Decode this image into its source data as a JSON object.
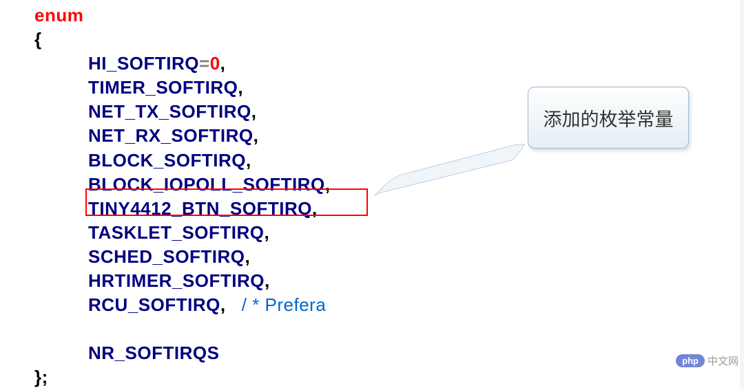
{
  "code": {
    "keyword": "enum",
    "openBrace": "{",
    "lines": [
      {
        "text": "HI_SOFTIRQ",
        "suffix": "=0,"
      },
      {
        "text": "TIMER_SOFTIRQ",
        "suffix": ","
      },
      {
        "text": "NET_TX_SOFTIRQ",
        "suffix": ","
      },
      {
        "text": "NET_RX_SOFTIRQ",
        "suffix": ","
      },
      {
        "text": "BLOCK_SOFTIRQ",
        "suffix": ","
      },
      {
        "text": "BLOCK_IOPOLL_SOFTIRQ",
        "suffix": ","
      },
      {
        "text": "TINY4412_BTN_SOFTIRQ",
        "suffix": ","
      },
      {
        "text": "TASKLET_SOFTIRQ",
        "suffix": ","
      },
      {
        "text": "SCHED_SOFTIRQ",
        "suffix": ","
      },
      {
        "text": "HRTIMER_SOFTIRQ",
        "suffix": ","
      },
      {
        "text": "RCU_SOFTIRQ",
        "suffix": ",",
        "comment": "   / * Prefera"
      },
      {
        "text": "",
        "suffix": ""
      },
      {
        "text": "NR_SOFTIRQS",
        "suffix": ""
      }
    ],
    "closeBrace": "};"
  },
  "callout": {
    "text": "添加的枚举常量"
  },
  "logo": {
    "badge": "php",
    "text": "中文网"
  }
}
